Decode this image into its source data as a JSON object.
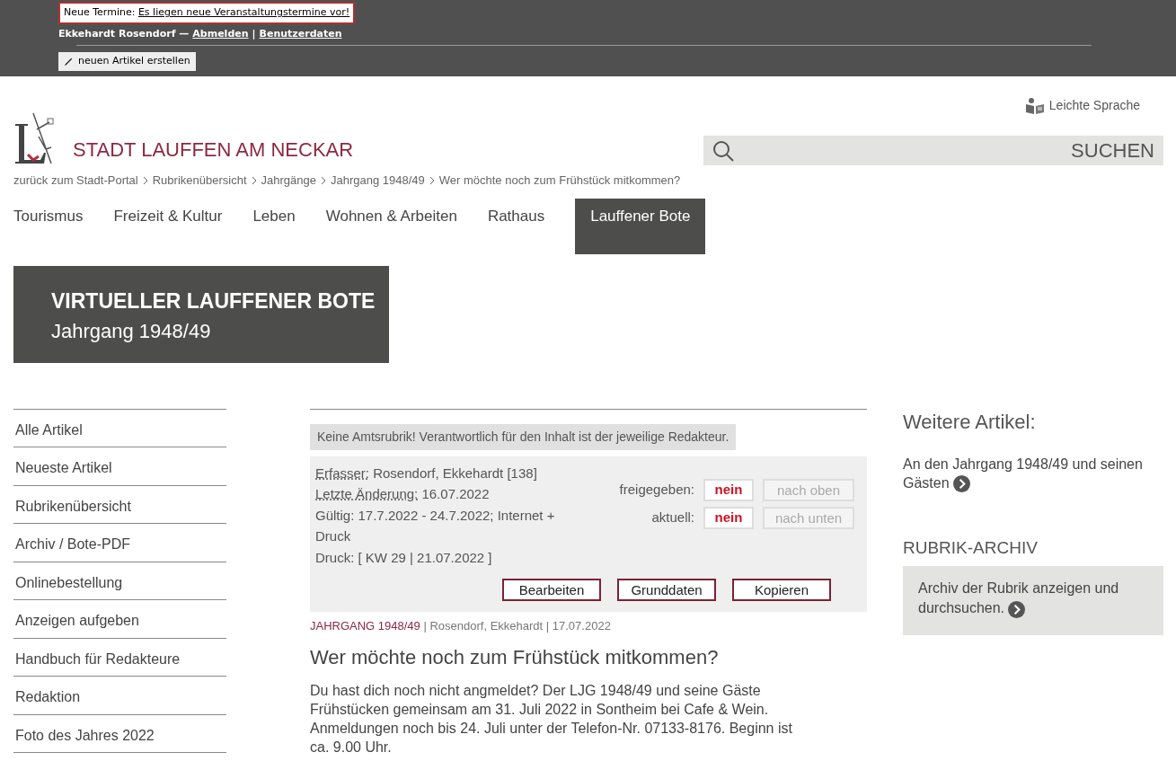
{
  "admin_bar": {
    "notice": {
      "label": "Neue Termine:",
      "link": "Es liegen neue Veranstaltungstermine vor!"
    },
    "user": {
      "name": "Ekkehardt Rosendorf —",
      "logout": "Abmelden",
      "separator": "|",
      "profile": "Benutzerdaten"
    },
    "new_article_button": "neuen Artikel erstellen"
  },
  "header": {
    "site_title": "STADT LAUFFEN AM NECKAR",
    "easy_language": "Leichte Sprache",
    "search": {
      "placeholder": "SUCHEN"
    }
  },
  "breadcrumbs": [
    "zurück zum Stadt-Portal",
    "Rubrikenübersicht",
    "Jahrgänge",
    "Jahrgang 1948/49",
    "Wer möchte noch zum Frühstück mitkommen?"
  ],
  "nav": [
    {
      "label": "Tourismus",
      "selected": false
    },
    {
      "label": "Freizeit & Kultur",
      "selected": false
    },
    {
      "label": "Leben",
      "selected": false
    },
    {
      "label": "Wohnen & Arbeiten",
      "selected": false
    },
    {
      "label": "Rathaus",
      "selected": false
    },
    {
      "label": "Lauffener Bote",
      "selected": true
    }
  ],
  "hero": {
    "title": "VIRTUELLER LAUFFENER BOTE",
    "subtitle": "Jahrgang 1948/49"
  },
  "sidebar": {
    "items": [
      "Alle Artikel",
      "Neueste Artikel",
      "Rubrikenübersicht",
      "Archiv / Bote-PDF",
      "Onlinebestellung",
      "Anzeigen aufgeben",
      "Handbuch für Redakteure",
      "Redaktion",
      "Foto des Jahres 2022"
    ]
  },
  "article": {
    "disclaimer": "Keine Amtsrubrik! Verantwortlich für den Inhalt ist der jeweilige Redakteur.",
    "meta": [
      {
        "label": "Erfasser:",
        "value": "Rosendorf, Ekkehardt [138]"
      },
      {
        "label": "Letzte Änderung:",
        "value": "16.07.2022"
      },
      {
        "value": "Gültig: 17.7.2022 - 24.7.2022; Internet + Druck"
      },
      {
        "value": "Druck: [ KW 29 | 21.07.2022 ]"
      }
    ],
    "status": [
      {
        "label": "freigegeben:",
        "value": "nein",
        "move": {
          "label": "nach oben",
          "disabled": true
        }
      },
      {
        "label": "aktuell:",
        "value": "nein",
        "move": {
          "label": "nach unten",
          "disabled": true
        }
      }
    ],
    "actions": [
      "Bearbeiten",
      "Grunddaten",
      "Kopieren"
    ],
    "category": "JAHRGANG 1948/49",
    "byline": "| Rosendorf, Ekkehardt | 17.07.2022",
    "title": "Wer möchte noch zum Frühstück mitkommen?",
    "body": "Du hast dich noch nicht angmeldet? Der LJG 1948/49 und seine Gäste Frühstücken gemeinsam am 31. Juli 2022 in Sontheim bei Cafe & Wein. Anmeldungen noch bis 24. Juli unter der Telefon-Nr. 07133-8176. Beginn ist ca. 9.00 Uhr."
  },
  "right": {
    "more_title": "Weitere Artikel:",
    "more_link": "An den Jahrgang 1948/49 und seinen Gästen",
    "archive_title": "RUBRIK-ARCHIV",
    "archive_link": "Archiv der Rubrik anzeigen und durchsuchen."
  }
}
